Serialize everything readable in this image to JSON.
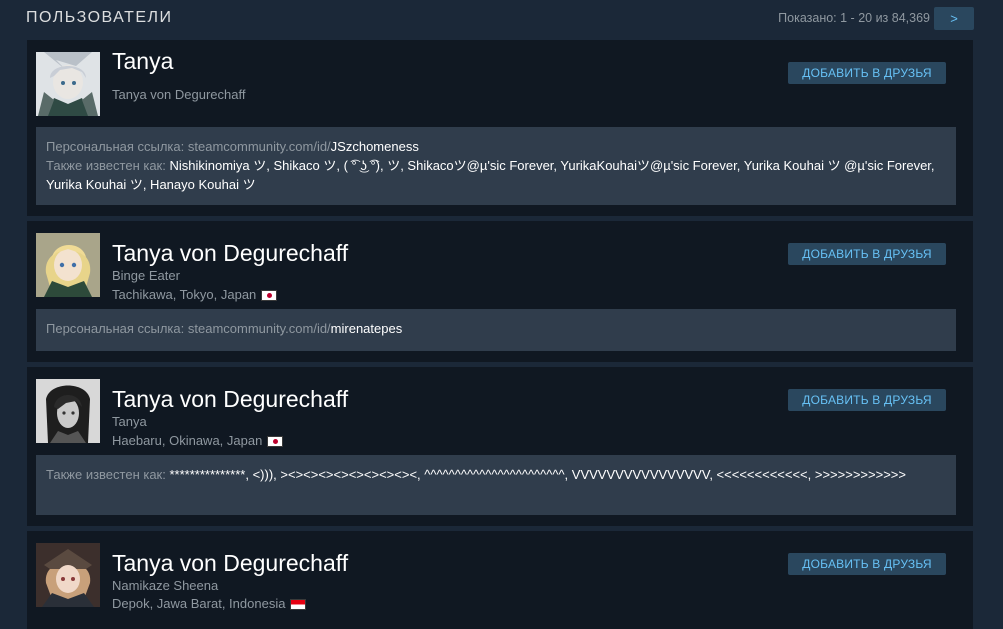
{
  "header": {
    "title": "ПОЛЬЗОВАТЕЛИ",
    "shown": "Показано: 1 - 20 из 84,369",
    "next_label": ">"
  },
  "labels": {
    "add_friend": "ДОБАВИТЬ В ДРУЗЬЯ",
    "custom_url": "Персональная ссылка: ",
    "custom_url_base": "steamcommunity.com/id/",
    "also_known_as": "Также известен как: "
  },
  "colors": {
    "background": "#1b2838",
    "card": "#101822",
    "info_panel": "#303d4c",
    "button_bg": "#2a475e",
    "button_text": "#67c1f5"
  },
  "users": [
    {
      "name": "Tanya",
      "real_name": "Tanya von Degurechaff",
      "url_id": "JSzchomeness",
      "aliases": "Nishikinomiya ツ, Shikaco ツ, ( ͡° ͜ʖ ͡°), ツ, Shikacoツ@µ'sic Forever, YurikaKouhaiツ@µ'sic Forever, Yurika Kouhai ツ @µ'sic Forever, Yurika Kouhai ツ, Hanayo Kouhai ツ"
    },
    {
      "name": "Tanya von Degurechaff",
      "real_name": "Binge Eater",
      "location": "Tachikawa, Tokyo, Japan",
      "flag": "jp-flag",
      "url_id": "mirenatepes"
    },
    {
      "name": "Tanya von Degurechaff",
      "real_name": "Tanya",
      "location": "Haebaru, Okinawa, Japan",
      "flag": "jp-flag",
      "aliases": "***************, <))), ><><><><><><><><><, ^^^^^^^^^^^^^^^^^^^^^^^, VVVVVVVVVVVVVVVV, <<<<<<<<<<<<, >>>>>>>>>>>>"
    },
    {
      "name": "Tanya von Degurechaff",
      "real_name": "Namikaze Sheena",
      "location": "Depok, Jawa Barat, Indonesia",
      "flag": "id-flag"
    }
  ]
}
